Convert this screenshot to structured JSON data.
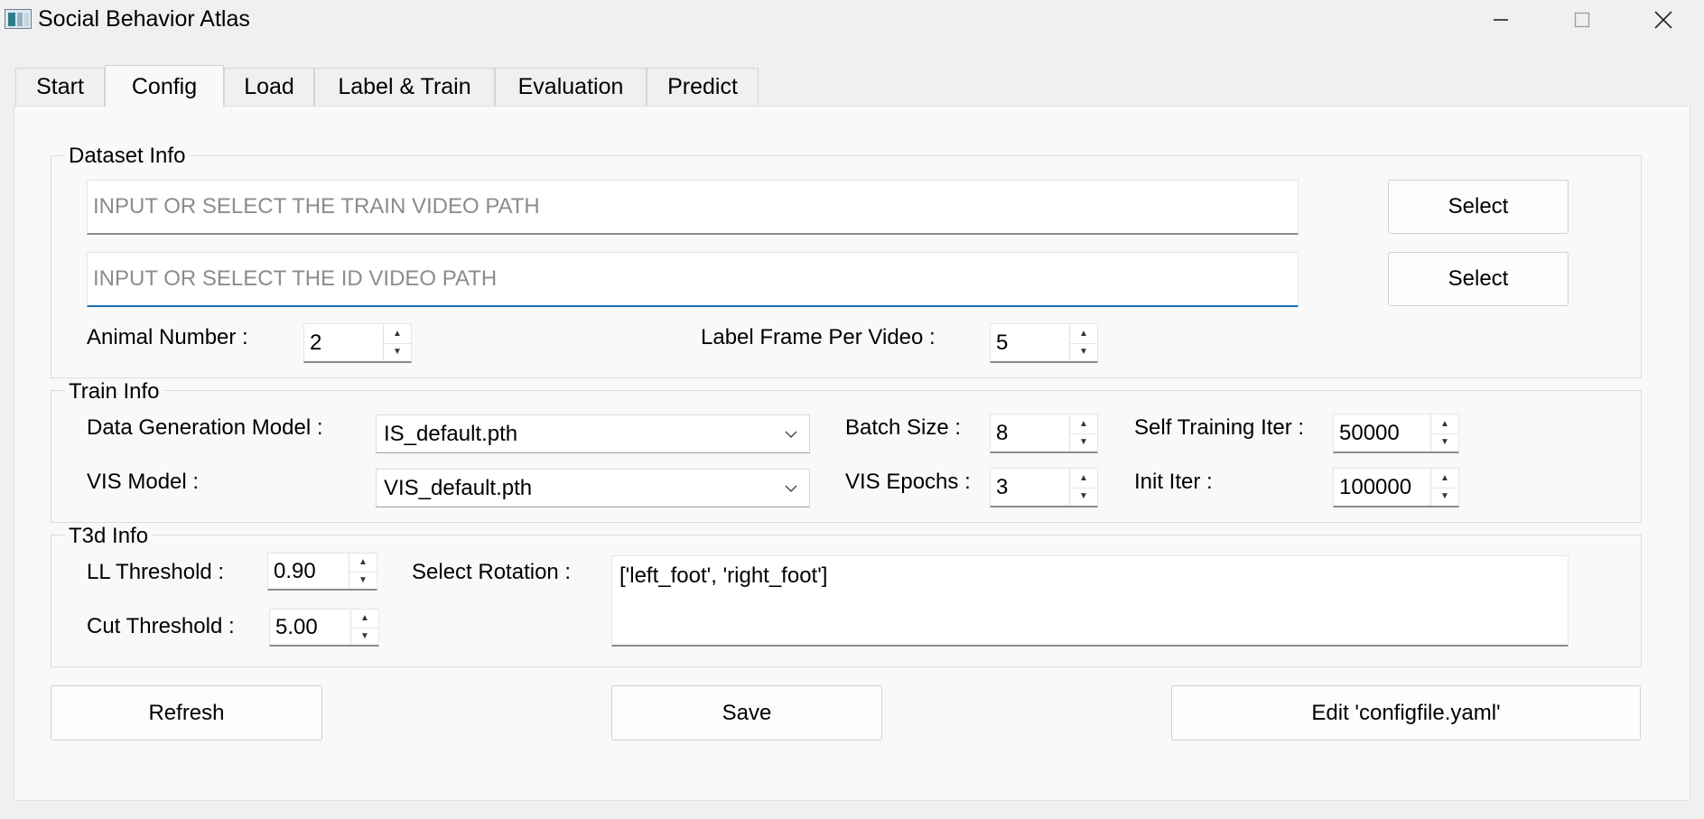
{
  "window": {
    "title": "Social Behavior Atlas"
  },
  "tabs": [
    {
      "label": "Start"
    },
    {
      "label": "Config"
    },
    {
      "label": "Load"
    },
    {
      "label": "Label & Train"
    },
    {
      "label": "Evaluation"
    },
    {
      "label": "Predict"
    }
  ],
  "active_tab": "Config",
  "dataset_info": {
    "title": "Dataset Info",
    "train_video_path": {
      "value": "",
      "placeholder": "INPUT OR SELECT THE TRAIN VIDEO PATH"
    },
    "id_video_path": {
      "value": "",
      "placeholder": "INPUT OR SELECT THE ID VIDEO PATH"
    },
    "select_train_label": "Select",
    "select_id_label": "Select",
    "animal_number_label": "Animal Number :",
    "animal_number_value": "2",
    "label_frame_label": "Label Frame Per Video :",
    "label_frame_value": "5"
  },
  "train_info": {
    "title": "Train Info",
    "data_generation_model_label": "Data Generation Model :",
    "data_generation_model_value": "IS_default.pth",
    "vis_model_label": "VIS Model :",
    "vis_model_value": "VIS_default.pth",
    "batch_size_label": "Batch Size :",
    "batch_size_value": "8",
    "vis_epochs_label": "VIS Epochs :",
    "vis_epochs_value": "3",
    "self_training_iter_label": "Self Training Iter :",
    "self_training_iter_value": "50000",
    "init_iter_label": "Init Iter :",
    "init_iter_value": "100000"
  },
  "t3d_info": {
    "title": "T3d Info",
    "ll_threshold_label": "LL Threshold :",
    "ll_threshold_value": "0.90",
    "cut_threshold_label": "Cut Threshold :",
    "cut_threshold_value": "5.00",
    "select_rotation_label": "Select Rotation :",
    "select_rotation_value": "['left_foot', 'right_foot']"
  },
  "actions": {
    "refresh_label": "Refresh",
    "save_label": "Save",
    "edit_label": "Edit 'configfile.yaml'"
  },
  "icons": {
    "app": "app-icon",
    "minimize": "minimize-icon",
    "maximize": "maximize-icon",
    "close": "close-icon",
    "spin_up": "arrow-up-icon",
    "spin_down": "arrow-down-icon",
    "dropdown": "chevron-down-icon"
  },
  "colors": {
    "focus_accent": "#1f6fb5",
    "window_bg": "#f0f0f0",
    "panel_bg": "#f9f9f9"
  }
}
